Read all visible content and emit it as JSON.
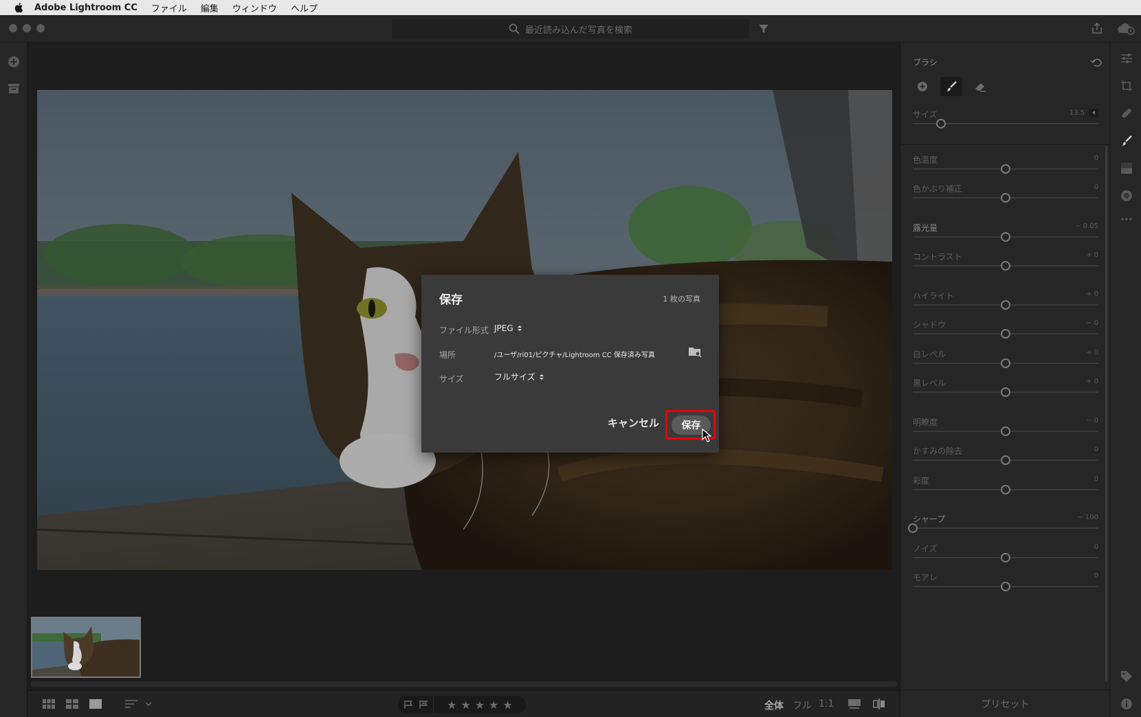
{
  "menubar": {
    "app_name": "Adobe Lightroom CC",
    "items": [
      "ファイル",
      "編集",
      "ウィンドウ",
      "ヘルプ"
    ]
  },
  "search": {
    "placeholder": "最近読み込んだ写真を検索"
  },
  "brush_panel": {
    "title": "ブラシ",
    "size_label": "サイズ",
    "size_value": "13.5",
    "size_level": 0.15,
    "sliders": [
      {
        "label": "色温度",
        "value": "0",
        "position": 0.5,
        "bright": false
      },
      {
        "label": "色かぶり補正",
        "value": "0",
        "position": 0.5,
        "bright": false
      },
      {
        "label": "露光量",
        "value": "− 0.05",
        "position": 0.5,
        "bright": true
      },
      {
        "label": "コントラスト",
        "value": "+ 0",
        "position": 0.5,
        "bright": false
      },
      {
        "label": "ハイライト",
        "value": "+ 0",
        "position": 0.5,
        "bright": false
      },
      {
        "label": "シャドウ",
        "value": "− 0",
        "position": 0.5,
        "bright": false
      },
      {
        "label": "白レベル",
        "value": "+ 0",
        "position": 0.5,
        "bright": false
      },
      {
        "label": "黒レベル",
        "value": "+ 0",
        "position": 0.5,
        "bright": false
      },
      {
        "label": "明瞭度",
        "value": "− 0",
        "position": 0.5,
        "bright": false
      },
      {
        "label": "かすみの除去",
        "value": "0",
        "position": 0.5,
        "bright": false
      },
      {
        "label": "彩度",
        "value": "0",
        "position": 0.5,
        "bright": false
      },
      {
        "label": "シャープ",
        "value": "− 100",
        "position": 0.0,
        "bright": true
      },
      {
        "label": "ノイズ",
        "value": "0",
        "position": 0.5,
        "bright": false
      },
      {
        "label": "モアレ",
        "value": "0",
        "position": 0.5,
        "bright": false
      }
    ],
    "presets_label": "プリセット"
  },
  "bottombar": {
    "zoom": [
      "全体",
      "フル",
      "1:1"
    ],
    "zoom_active": "全体",
    "stars": [
      "★",
      "★",
      "★",
      "★",
      "★"
    ]
  },
  "save_dialog": {
    "title": "保存",
    "photo_count": "1 枚の写真",
    "format_label": "ファイル形式",
    "format_value": "JPEG",
    "location_label": "場所",
    "location_value": "/ユーザ/ri01/ピクチャ/Lightroom CC 保存済み写真",
    "size_label": "サイズ",
    "size_value": "フルサイズ",
    "cancel_label": "キャンセル",
    "save_label": "保存"
  },
  "colors": {
    "highlight_border": "#e8000c",
    "panel_bg": "#262626",
    "dialog_bg": "#3a3a3a"
  }
}
